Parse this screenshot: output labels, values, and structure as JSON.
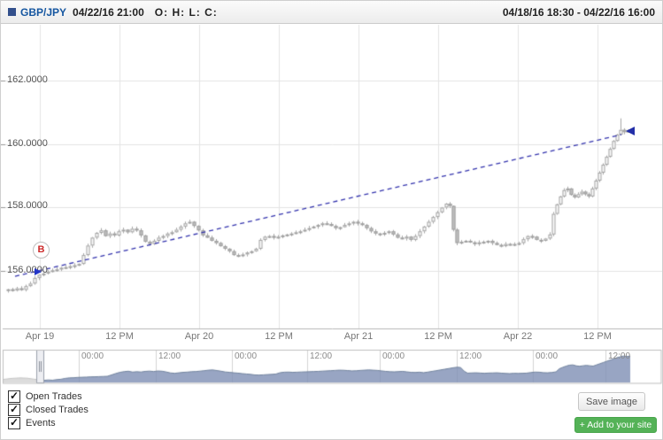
{
  "header": {
    "symbol": "GBP/JPY",
    "timestamp": "04/22/16 21:00",
    "ohlc_label": "O: H: L: C:",
    "range": "04/18/16 18:30 - 04/22/16 16:00"
  },
  "legend": {
    "items": [
      {
        "label": "Open Trades",
        "checked": true
      },
      {
        "label": "Closed Trades",
        "checked": true
      },
      {
        "label": "Events",
        "checked": true
      }
    ],
    "check_glyph": "✓"
  },
  "buttons": {
    "save_image": "Save image",
    "add_to_site": "+ Add to your site"
  },
  "chart_data": {
    "type": "candlestick",
    "title": "GBP/JPY",
    "time_range": "04/18/16 18:30 - 04/22/16 16:00",
    "y_ticks": [
      "162.0000",
      "160.0000",
      "158.0000",
      "156.0000"
    ],
    "y_tick_values": [
      162,
      160,
      158,
      156
    ],
    "x_ticks": [
      "Apr 19",
      "12 PM",
      "Apr 20",
      "12 PM",
      "Apr 21",
      "12 PM",
      "Apr 22",
      "12 PM"
    ],
    "nav_ticks": [
      "00:00",
      "12:00",
      "00:00",
      "12:00",
      "00:00",
      "12:00",
      "00:00",
      "12:00"
    ],
    "ylim": [
      154.2,
      163.8
    ],
    "grid": true,
    "colors": {
      "candle_up_fill": "#fdfdfd",
      "candle_down_fill": "#bfbfbf",
      "candle_stroke": "#a0a0a0",
      "trendline": "#3434ae",
      "marker_letter": "#cc2a2a",
      "nav_fill": "rgba(126,143,180,0.8)",
      "nav_line": "#72849f",
      "nav_pre_fill": "#dcdcdc",
      "grid_color": "#e4e4e4"
    },
    "marker": {
      "label": "B",
      "price": 156.6
    },
    "trendline": {
      "from_price": 155.83,
      "to_price": 160.3,
      "style": "dashed"
    },
    "closes": [
      [
        8,
        155.42
      ],
      [
        13,
        155.38
      ],
      [
        18,
        155.45
      ],
      [
        23,
        155.4
      ],
      [
        28,
        155.52
      ],
      [
        33,
        155.6
      ],
      [
        38,
        155.78
      ],
      [
        43,
        155.88
      ],
      [
        48,
        155.92
      ],
      [
        53,
        155.98
      ],
      [
        58,
        156.02
      ],
      [
        63,
        156.05
      ],
      [
        68,
        156.1
      ],
      [
        73,
        156.12
      ],
      [
        78,
        156.15
      ],
      [
        83,
        156.18
      ],
      [
        88,
        156.22
      ],
      [
        93,
        156.5
      ],
      [
        98,
        156.8
      ],
      [
        103,
        157.05
      ],
      [
        108,
        157.2
      ],
      [
        113,
        157.28
      ],
      [
        118,
        157.1
      ],
      [
        123,
        157.18
      ],
      [
        128,
        157.12
      ],
      [
        133,
        157.25
      ],
      [
        138,
        157.3
      ],
      [
        143,
        157.22
      ],
      [
        148,
        157.33
      ],
      [
        153,
        157.28
      ],
      [
        158,
        157.12
      ],
      [
        163,
        156.92
      ],
      [
        168,
        156.85
      ],
      [
        173,
        156.95
      ],
      [
        178,
        157.05
      ],
      [
        183,
        157.1
      ],
      [
        188,
        157.18
      ],
      [
        193,
        157.22
      ],
      [
        198,
        157.3
      ],
      [
        203,
        157.4
      ],
      [
        208,
        157.5
      ],
      [
        213,
        157.55
      ],
      [
        218,
        157.42
      ],
      [
        223,
        157.28
      ],
      [
        228,
        157.12
      ],
      [
        233,
        157.05
      ],
      [
        238,
        156.95
      ],
      [
        243,
        156.88
      ],
      [
        248,
        156.78
      ],
      [
        253,
        156.7
      ],
      [
        258,
        156.62
      ],
      [
        263,
        156.5
      ],
      [
        268,
        156.48
      ],
      [
        273,
        156.52
      ],
      [
        278,
        156.58
      ],
      [
        283,
        156.62
      ],
      [
        288,
        156.7
      ],
      [
        293,
        156.98
      ],
      [
        298,
        157.08
      ],
      [
        303,
        157.1
      ],
      [
        308,
        157.05
      ],
      [
        313,
        157.08
      ],
      [
        318,
        157.12
      ],
      [
        323,
        157.15
      ],
      [
        328,
        157.18
      ],
      [
        333,
        157.22
      ],
      [
        338,
        157.25
      ],
      [
        343,
        157.3
      ],
      [
        348,
        157.35
      ],
      [
        353,
        157.4
      ],
      [
        358,
        157.45
      ],
      [
        363,
        157.5
      ],
      [
        368,
        157.48
      ],
      [
        373,
        157.42
      ],
      [
        378,
        157.35
      ],
      [
        383,
        157.38
      ],
      [
        388,
        157.45
      ],
      [
        393,
        157.5
      ],
      [
        398,
        157.55
      ],
      [
        403,
        157.5
      ],
      [
        408,
        157.45
      ],
      [
        413,
        157.35
      ],
      [
        418,
        157.25
      ],
      [
        423,
        157.18
      ],
      [
        428,
        157.15
      ],
      [
        433,
        157.2
      ],
      [
        438,
        157.25
      ],
      [
        443,
        157.15
      ],
      [
        448,
        157.05
      ],
      [
        453,
        157.02
      ],
      [
        458,
        157.08
      ],
      [
        463,
        156.98
      ],
      [
        468,
        157.1
      ],
      [
        473,
        157.25
      ],
      [
        478,
        157.4
      ],
      [
        483,
        157.55
      ],
      [
        488,
        157.7
      ],
      [
        493,
        157.85
      ],
      [
        498,
        158.0
      ],
      [
        503,
        158.12
      ],
      [
        507,
        158.05
      ],
      [
        511,
        157.3
      ],
      [
        515,
        156.88
      ],
      [
        520,
        156.92
      ],
      [
        525,
        156.95
      ],
      [
        530,
        156.9
      ],
      [
        535,
        156.85
      ],
      [
        540,
        156.9
      ],
      [
        545,
        156.92
      ],
      [
        550,
        156.95
      ],
      [
        555,
        156.88
      ],
      [
        560,
        156.82
      ],
      [
        565,
        156.78
      ],
      [
        570,
        156.85
      ],
      [
        575,
        156.82
      ],
      [
        580,
        156.85
      ],
      [
        585,
        156.88
      ],
      [
        590,
        157.0
      ],
      [
        595,
        157.1
      ],
      [
        600,
        157.08
      ],
      [
        605,
        156.98
      ],
      [
        610,
        156.95
      ],
      [
        615,
        157.02
      ],
      [
        620,
        157.15
      ],
      [
        624,
        157.8
      ],
      [
        628,
        158.1
      ],
      [
        632,
        158.35
      ],
      [
        636,
        158.55
      ],
      [
        640,
        158.6
      ],
      [
        644,
        158.4
      ],
      [
        648,
        158.32
      ],
      [
        652,
        158.42
      ],
      [
        656,
        158.5
      ],
      [
        660,
        158.42
      ],
      [
        664,
        158.35
      ],
      [
        668,
        158.6
      ],
      [
        672,
        158.85
      ],
      [
        676,
        159.1
      ],
      [
        680,
        159.35
      ],
      [
        684,
        159.6
      ],
      [
        688,
        159.85
      ],
      [
        692,
        160.1
      ],
      [
        696,
        160.3
      ],
      [
        700,
        160.45
      ],
      [
        704,
        160.38
      ],
      [
        708,
        160.42
      ]
    ],
    "navigator_pre_range": [
      [
        2,
        155.55
      ],
      [
        12,
        155.78
      ],
      [
        22,
        155.88
      ],
      [
        30,
        155.82
      ],
      [
        38,
        155.6
      ],
      [
        44,
        155.48
      ]
    ]
  }
}
